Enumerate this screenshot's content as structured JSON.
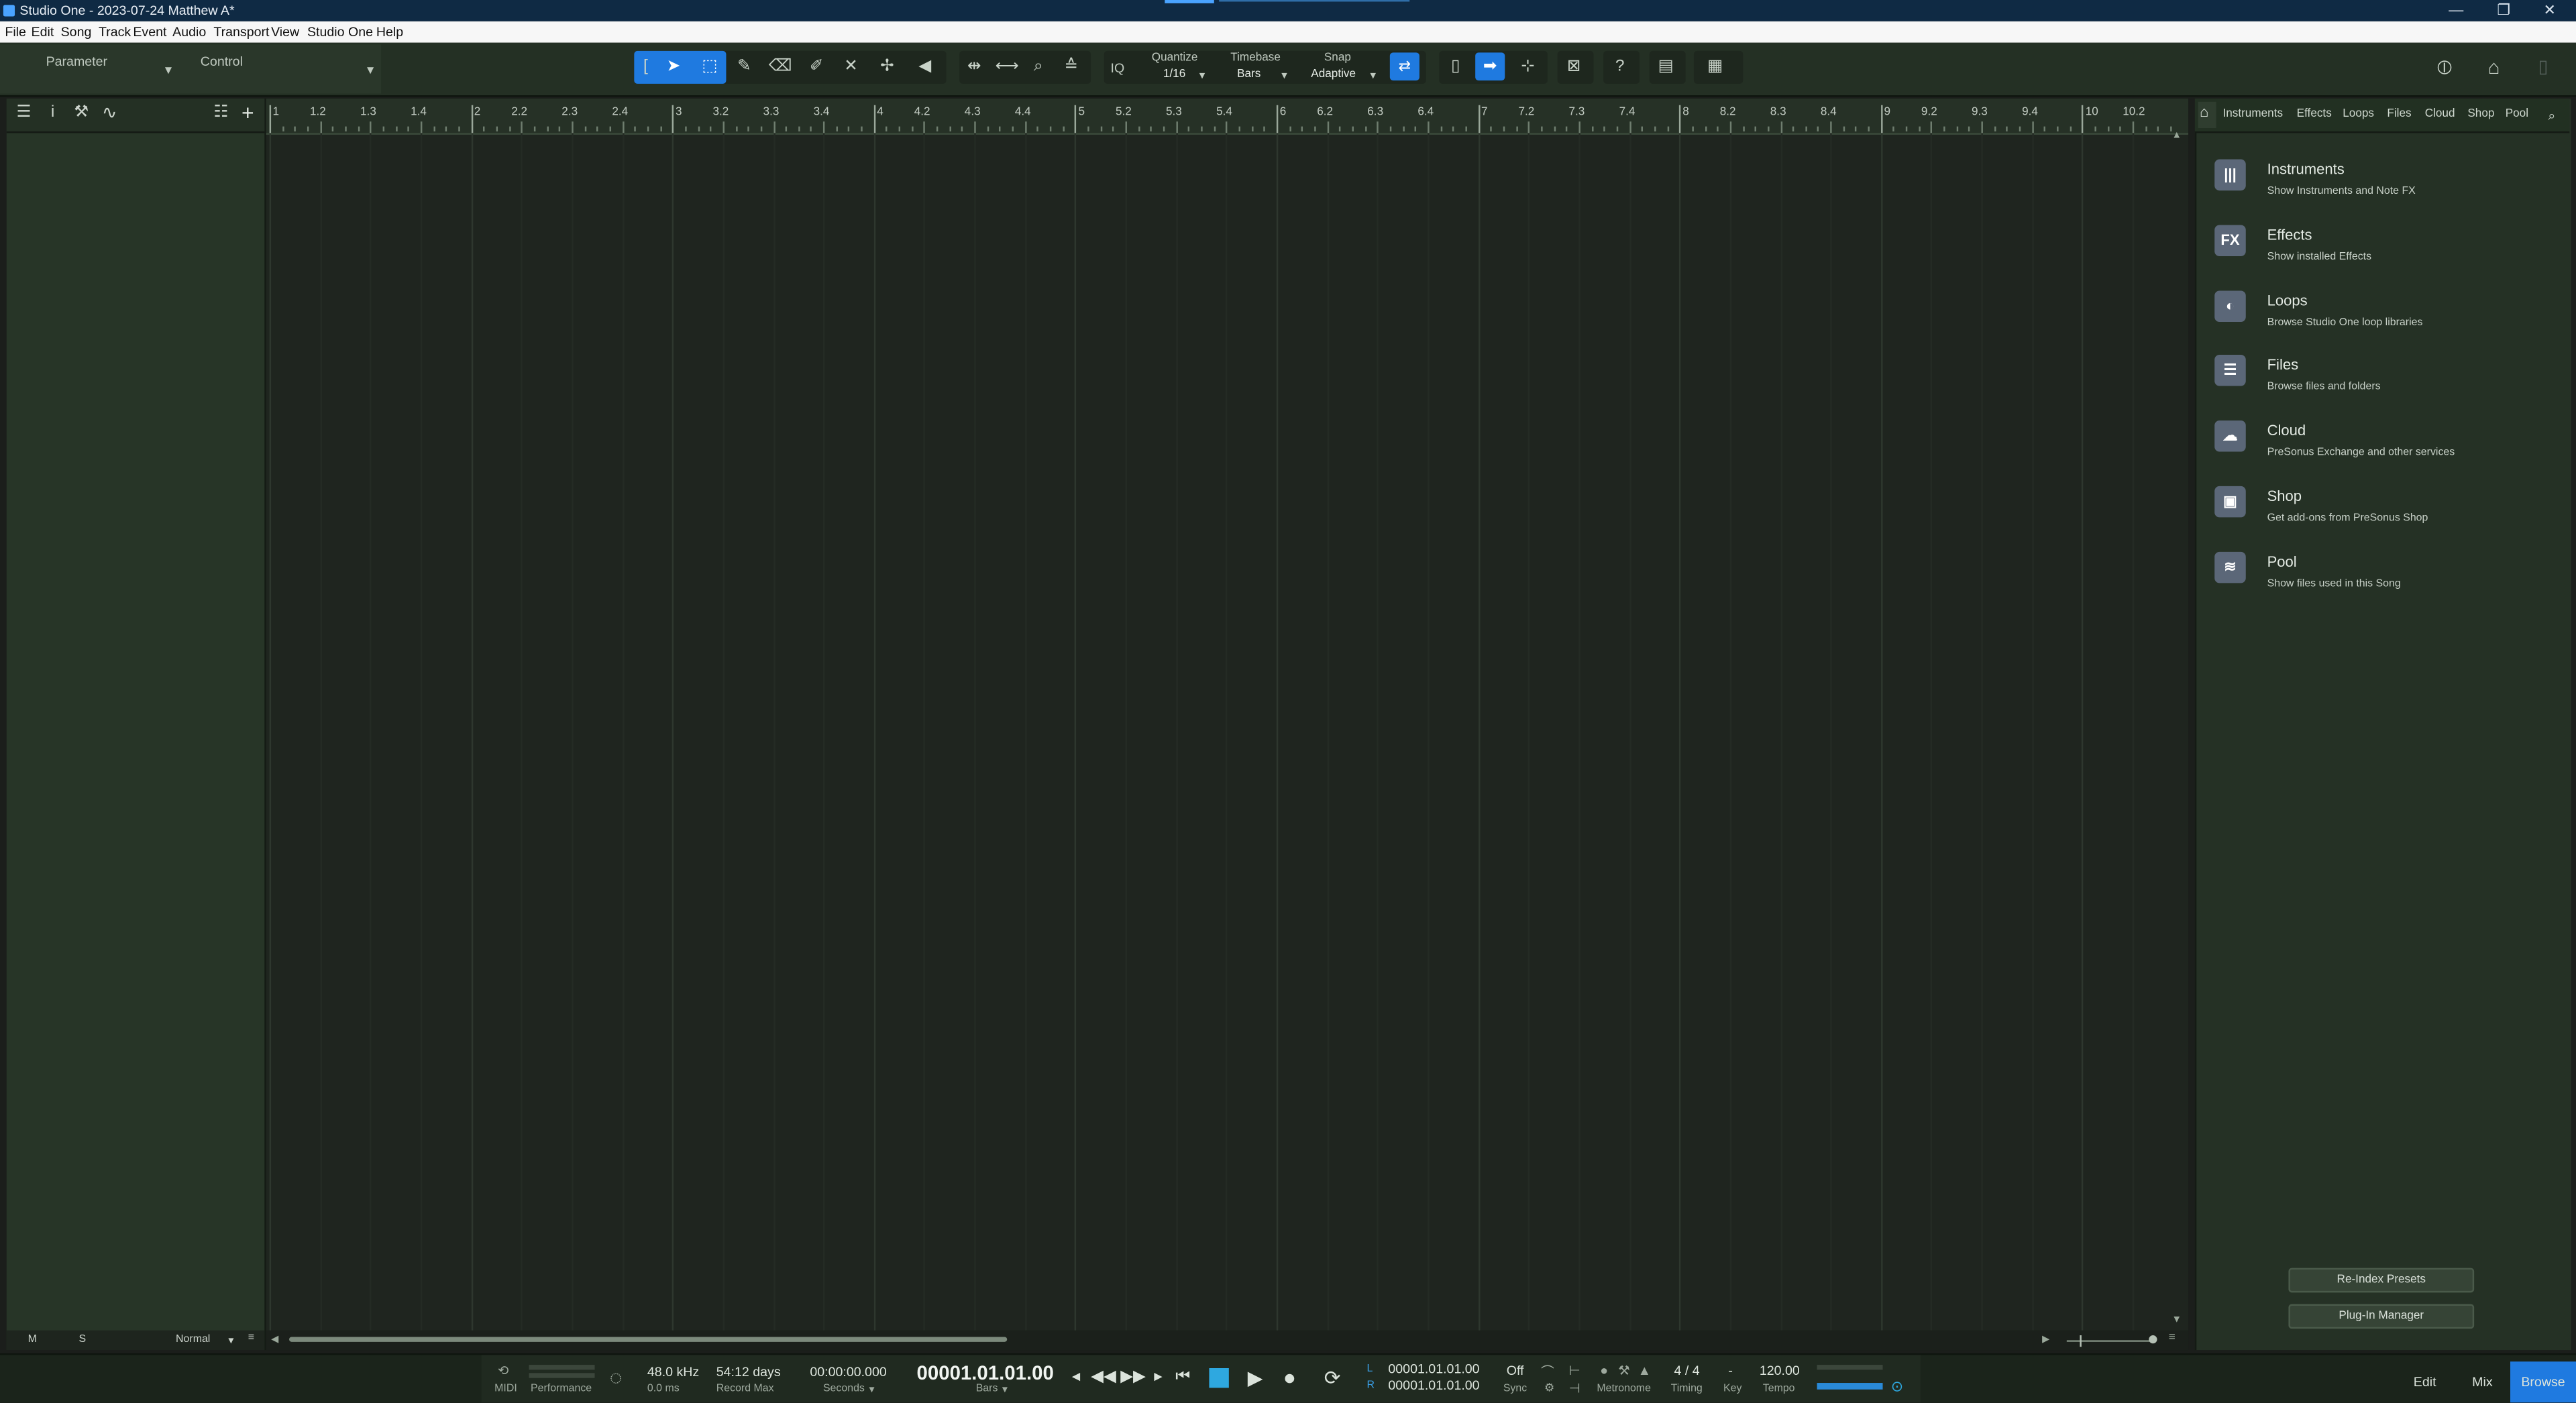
{
  "window": {
    "title": "Studio One - 2023-07-24 Matthew A*",
    "min": "—",
    "max": "❐",
    "close": "✕"
  },
  "menu": [
    "File",
    "Edit",
    "Song",
    "Track",
    "Event",
    "Audio",
    "Transport",
    "View",
    "Studio One",
    "Help"
  ],
  "toolbar": {
    "parameter_label": "Parameter",
    "control_label": "Control",
    "iq": "IQ",
    "quantize_label": "Quantize",
    "quantize_value": "1/16",
    "timebase_label": "Timebase",
    "timebase_value": "Bars",
    "snap_label": "Snap",
    "snap_value": "Adaptive",
    "help": "?"
  },
  "ruler": {
    "bars": [
      {
        "n": "1",
        "minors": [
          "1.2",
          "1.3",
          "1.4"
        ]
      },
      {
        "n": "2",
        "minors": [
          "2.2",
          "2.3",
          "2.4"
        ]
      },
      {
        "n": "3",
        "minors": [
          "3.2",
          "3.3",
          "3.4"
        ]
      },
      {
        "n": "4",
        "minors": [
          "4.2",
          "4.3",
          "4.4"
        ]
      },
      {
        "n": "5",
        "minors": [
          "5.2",
          "5.3",
          "5.4"
        ]
      },
      {
        "n": "6",
        "minors": [
          "6.2",
          "6.3",
          "6.4"
        ]
      },
      {
        "n": "7",
        "minors": [
          "7.2",
          "7.3",
          "7.4"
        ]
      },
      {
        "n": "8",
        "minors": [
          "8.2",
          "8.3",
          "8.4"
        ]
      },
      {
        "n": "9",
        "minors": [
          "9.2",
          "9.3",
          "9.4"
        ]
      },
      {
        "n": "10",
        "minors": [
          "10.2"
        ]
      }
    ]
  },
  "left_strip": {
    "mute": "M",
    "solo": "S",
    "mode": "Normal"
  },
  "browser": {
    "tabs": [
      "Instruments",
      "Effects",
      "Loops",
      "Files",
      "Cloud",
      "Shop",
      "Pool"
    ],
    "items": [
      {
        "title": "Instruments",
        "subtitle": "Show Instruments and Note FX",
        "icon": "piano-icon",
        "glyph": "|||"
      },
      {
        "title": "Effects",
        "subtitle": "Show installed Effects",
        "icon": "fx-icon",
        "glyph": "FX"
      },
      {
        "title": "Loops",
        "subtitle": "Browse Studio One loop libraries",
        "icon": "loop-icon",
        "glyph": "◐"
      },
      {
        "title": "Files",
        "subtitle": "Browse files and folders",
        "icon": "files-icon",
        "glyph": "☰"
      },
      {
        "title": "Cloud",
        "subtitle": "PreSonus Exchange and other services",
        "icon": "cloud-icon",
        "glyph": "☁"
      },
      {
        "title": "Shop",
        "subtitle": "Get add-ons from PreSonus Shop",
        "icon": "shop-icon",
        "glyph": "▣"
      },
      {
        "title": "Pool",
        "subtitle": "Show files used in this Song",
        "icon": "pool-icon",
        "glyph": "≋"
      }
    ],
    "reindex": "Re-Index Presets",
    "plugin_manager": "Plug-In Manager"
  },
  "transport": {
    "midi": "MIDI",
    "performance": "Performance",
    "sample_rate": "48.0 kHz",
    "latency": "0.0 ms",
    "record_max_value": "54:12 days",
    "record_max_label": "Record Max",
    "seconds_value": "00:00:00.000",
    "seconds_label": "Seconds",
    "position": "00001.01.01.00",
    "position_label": "Bars",
    "loop_l_label": "L",
    "loop_r_label": "R",
    "loop_l": "00001.01.01.00",
    "loop_r": "00001.01.01.00",
    "sync_value": "Off",
    "sync_label": "Sync",
    "metronome_label": "Metronome",
    "timing_value": "4 / 4",
    "timing_label": "Timing",
    "key_value": "-",
    "key_label": "Key",
    "tempo_value": "120.00",
    "tempo_label": "Tempo"
  },
  "modes": {
    "edit": "Edit",
    "mix": "Mix",
    "browse": "Browse"
  },
  "colors": {
    "accent": "#1f7ae0",
    "titlebar": "#0f2a44",
    "panel": "#273527"
  }
}
